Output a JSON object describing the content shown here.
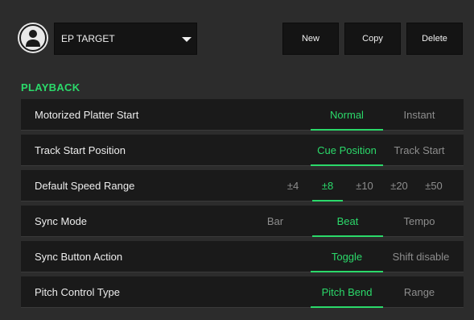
{
  "header": {
    "profile": "EP TARGET",
    "buttons": {
      "new": "New",
      "copy": "Copy",
      "delete": "Delete"
    }
  },
  "section": "PLAYBACK",
  "accent_color": "#2bd96a",
  "rows": [
    {
      "label": "Motorized Platter Start",
      "options": [
        "Normal",
        "Instant"
      ],
      "selected": "Normal"
    },
    {
      "label": "Track Start Position",
      "options": [
        "Cue Position",
        "Track Start"
      ],
      "selected": "Cue Position"
    },
    {
      "label": "Default Speed Range",
      "options": [
        "±4",
        "±8",
        "±10",
        "±20",
        "±50"
      ],
      "selected": "±8"
    },
    {
      "label": "Sync Mode",
      "options": [
        "Bar",
        "Beat",
        "Tempo"
      ],
      "selected": "Beat"
    },
    {
      "label": "Sync Button Action",
      "options": [
        "Toggle",
        "Shift disable"
      ],
      "selected": "Toggle"
    },
    {
      "label": "Pitch Control Type",
      "options": [
        "Pitch Bend",
        "Range"
      ],
      "selected": "Pitch Bend"
    }
  ]
}
